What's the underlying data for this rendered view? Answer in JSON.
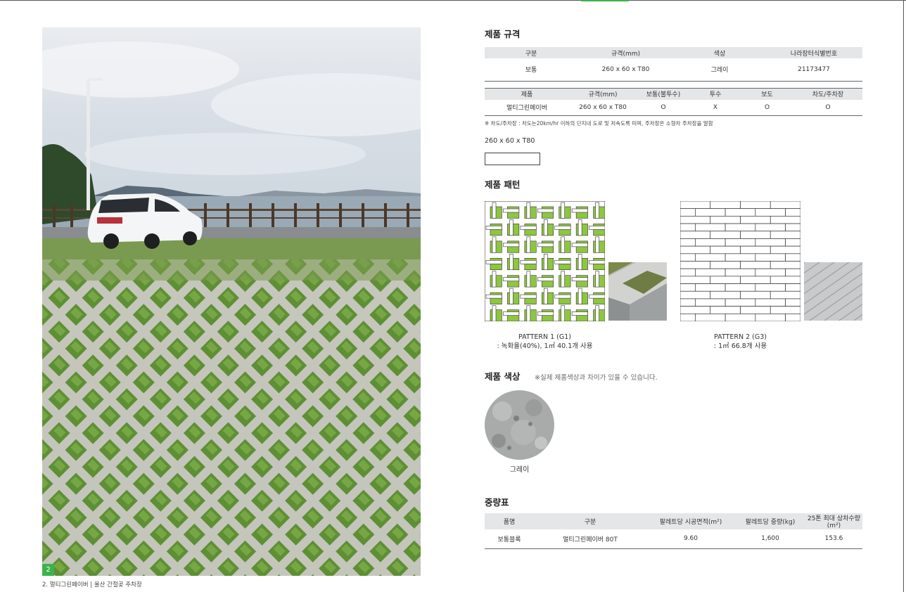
{
  "page": {
    "number": "2",
    "caption": "2. 멀티그린페이버 | 울산 간절곶 주차장"
  },
  "colors": {
    "accent": "#3cb34a",
    "table_header_bg": "#e5e6e8",
    "grass_pattern": "#8dc63f"
  },
  "spec": {
    "title": "제품 규격",
    "headers": [
      "구분",
      "규격(mm)",
      "색상",
      "나라장터식별번호"
    ],
    "rows": [
      [
        "보통",
        "260 x 60 x T80",
        "그레이",
        "21173477"
      ]
    ]
  },
  "usage": {
    "headers": [
      "제품",
      "규격(mm)",
      "보통(불투수)",
      "투수",
      "보도",
      "차도/주차장"
    ],
    "rows": [
      [
        "멀티그린페이버",
        "260 x 60 x T80",
        "O",
        "X",
        "O",
        "O"
      ]
    ],
    "note": "※ 차도/주차장 : 차도는20km/hr 이하의 단지내 도로 및 저속도록 미며, 주차장은 소형차 주차장을 말함"
  },
  "size_label": "260 x 60 x T80",
  "patterns": {
    "title": "제품 패턴",
    "items": [
      {
        "name": "PATTERN 1 (G1)",
        "desc": ": 녹화율(40%), 1㎡ 40.1개 사용"
      },
      {
        "name": "PATTERN 2 (G3)",
        "desc": ": 1㎡ 66.8개 사용"
      }
    ]
  },
  "color_section": {
    "title": "제품 색상",
    "note": "※실제 제품색상과 차이가 있을 수 있습니다.",
    "swatches": [
      {
        "label": "그레이"
      }
    ]
  },
  "weight": {
    "title": "중량표",
    "headers": [
      "품명",
      "구분",
      "팔레트당 시공면적(m²)",
      "팔레트당 중량(kg)",
      "25톤 최대 상차수량(m²)"
    ],
    "rows": [
      [
        "보통블록",
        "멀티그린페이버 80T",
        "9.60",
        "1,600",
        "153.6"
      ]
    ]
  }
}
